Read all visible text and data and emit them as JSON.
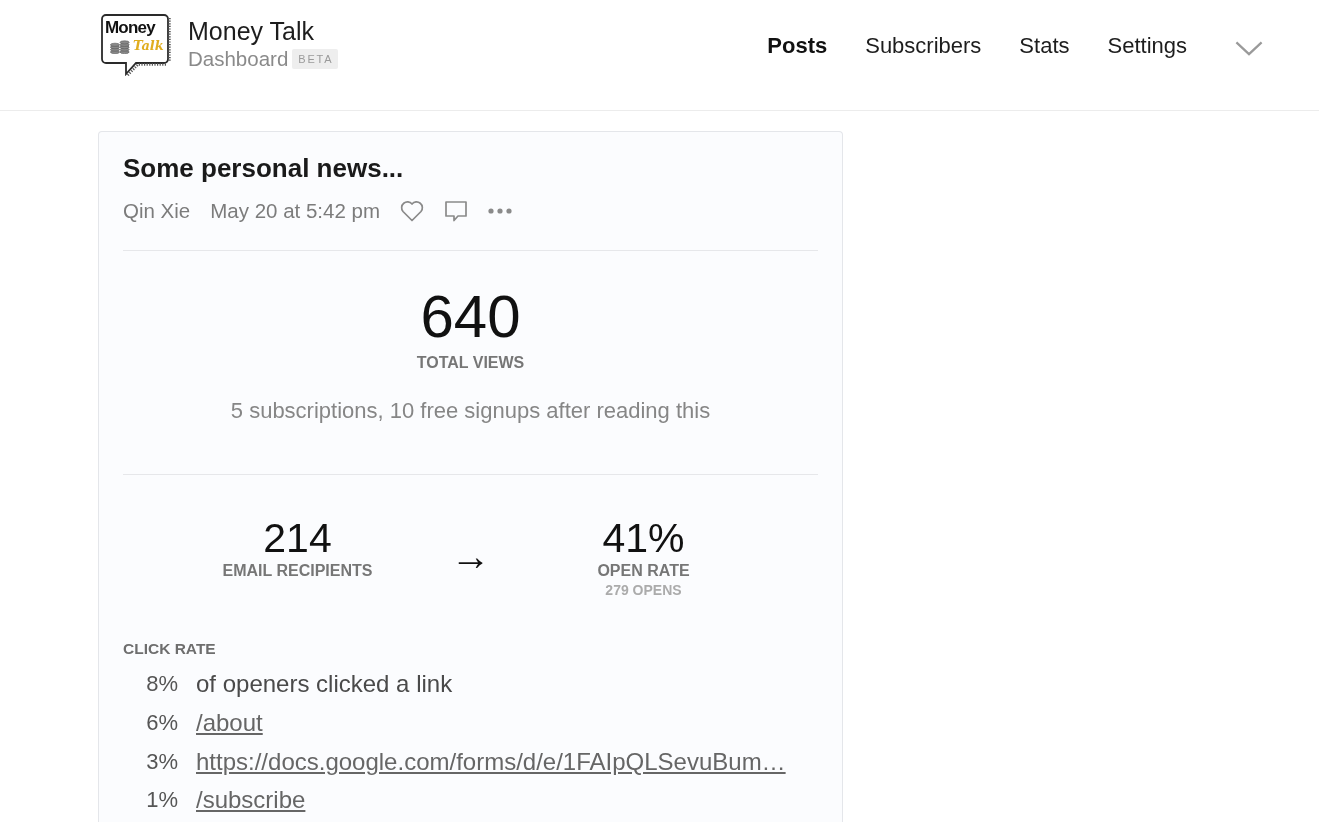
{
  "header": {
    "logo": {
      "line_1": "Money",
      "line_2": "Talk"
    },
    "title": "Money Talk",
    "subtitle": "Dashboard",
    "badge": "BETA"
  },
  "nav": [
    {
      "label": "Posts",
      "selected": true
    },
    {
      "label": "Subscribers",
      "selected": false
    },
    {
      "label": "Stats",
      "selected": false
    },
    {
      "label": "Settings",
      "selected": false
    }
  ],
  "post": {
    "title": "Some personal news...",
    "author": "Qin Xie",
    "date": "May 20 at 5:42 pm",
    "total_views": {
      "value": "640",
      "label": "TOTAL VIEWS"
    },
    "signups": "5 subscriptions, 10 free signups after reading this",
    "email": {
      "recipients": {
        "value": "214",
        "label": "EMAIL RECIPIENTS"
      },
      "arrow": "→",
      "open_rate": {
        "value": "41%",
        "label": "OPEN RATE",
        "detail": "279 OPENS"
      }
    },
    "click_rate": {
      "heading": "CLICK RATE",
      "rows": [
        {
          "kind": "summary",
          "percent": "8%",
          "text": "of openers clicked a link"
        },
        {
          "kind": "link",
          "percent": "6%",
          "text": "/about"
        },
        {
          "kind": "link",
          "percent": "3%",
          "text": "https://docs.google.com/forms/d/e/1FAIpQLSevuBum…"
        },
        {
          "kind": "link",
          "percent": "1%",
          "text": "/subscribe"
        }
      ]
    }
  }
}
